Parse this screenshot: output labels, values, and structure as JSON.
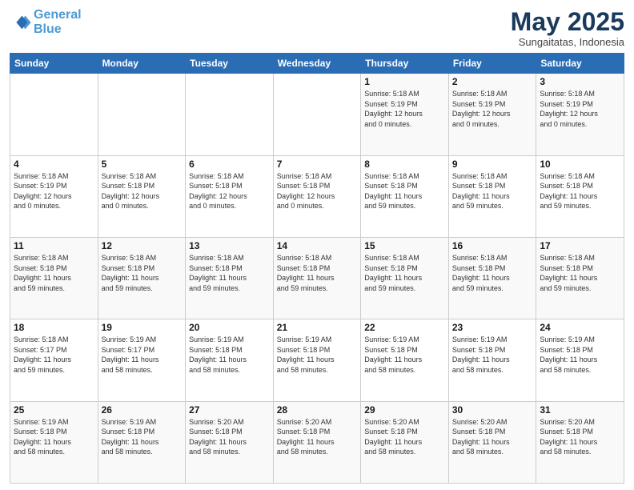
{
  "header": {
    "logo_line1": "General",
    "logo_line2": "Blue",
    "month": "May 2025",
    "location": "Sungaitatas, Indonesia"
  },
  "weekdays": [
    "Sunday",
    "Monday",
    "Tuesday",
    "Wednesday",
    "Thursday",
    "Friday",
    "Saturday"
  ],
  "weeks": [
    [
      {
        "day": "",
        "text": ""
      },
      {
        "day": "",
        "text": ""
      },
      {
        "day": "",
        "text": ""
      },
      {
        "day": "",
        "text": ""
      },
      {
        "day": "1",
        "text": "Sunrise: 5:18 AM\nSunset: 5:19 PM\nDaylight: 12 hours\nand 0 minutes."
      },
      {
        "day": "2",
        "text": "Sunrise: 5:18 AM\nSunset: 5:19 PM\nDaylight: 12 hours\nand 0 minutes."
      },
      {
        "day": "3",
        "text": "Sunrise: 5:18 AM\nSunset: 5:19 PM\nDaylight: 12 hours\nand 0 minutes."
      }
    ],
    [
      {
        "day": "4",
        "text": "Sunrise: 5:18 AM\nSunset: 5:19 PM\nDaylight: 12 hours\nand 0 minutes."
      },
      {
        "day": "5",
        "text": "Sunrise: 5:18 AM\nSunset: 5:18 PM\nDaylight: 12 hours\nand 0 minutes."
      },
      {
        "day": "6",
        "text": "Sunrise: 5:18 AM\nSunset: 5:18 PM\nDaylight: 12 hours\nand 0 minutes."
      },
      {
        "day": "7",
        "text": "Sunrise: 5:18 AM\nSunset: 5:18 PM\nDaylight: 12 hours\nand 0 minutes."
      },
      {
        "day": "8",
        "text": "Sunrise: 5:18 AM\nSunset: 5:18 PM\nDaylight: 11 hours\nand 59 minutes."
      },
      {
        "day": "9",
        "text": "Sunrise: 5:18 AM\nSunset: 5:18 PM\nDaylight: 11 hours\nand 59 minutes."
      },
      {
        "day": "10",
        "text": "Sunrise: 5:18 AM\nSunset: 5:18 PM\nDaylight: 11 hours\nand 59 minutes."
      }
    ],
    [
      {
        "day": "11",
        "text": "Sunrise: 5:18 AM\nSunset: 5:18 PM\nDaylight: 11 hours\nand 59 minutes."
      },
      {
        "day": "12",
        "text": "Sunrise: 5:18 AM\nSunset: 5:18 PM\nDaylight: 11 hours\nand 59 minutes."
      },
      {
        "day": "13",
        "text": "Sunrise: 5:18 AM\nSunset: 5:18 PM\nDaylight: 11 hours\nand 59 minutes."
      },
      {
        "day": "14",
        "text": "Sunrise: 5:18 AM\nSunset: 5:18 PM\nDaylight: 11 hours\nand 59 minutes."
      },
      {
        "day": "15",
        "text": "Sunrise: 5:18 AM\nSunset: 5:18 PM\nDaylight: 11 hours\nand 59 minutes."
      },
      {
        "day": "16",
        "text": "Sunrise: 5:18 AM\nSunset: 5:18 PM\nDaylight: 11 hours\nand 59 minutes."
      },
      {
        "day": "17",
        "text": "Sunrise: 5:18 AM\nSunset: 5:18 PM\nDaylight: 11 hours\nand 59 minutes."
      }
    ],
    [
      {
        "day": "18",
        "text": "Sunrise: 5:18 AM\nSunset: 5:17 PM\nDaylight: 11 hours\nand 59 minutes."
      },
      {
        "day": "19",
        "text": "Sunrise: 5:19 AM\nSunset: 5:17 PM\nDaylight: 11 hours\nand 58 minutes."
      },
      {
        "day": "20",
        "text": "Sunrise: 5:19 AM\nSunset: 5:18 PM\nDaylight: 11 hours\nand 58 minutes."
      },
      {
        "day": "21",
        "text": "Sunrise: 5:19 AM\nSunset: 5:18 PM\nDaylight: 11 hours\nand 58 minutes."
      },
      {
        "day": "22",
        "text": "Sunrise: 5:19 AM\nSunset: 5:18 PM\nDaylight: 11 hours\nand 58 minutes."
      },
      {
        "day": "23",
        "text": "Sunrise: 5:19 AM\nSunset: 5:18 PM\nDaylight: 11 hours\nand 58 minutes."
      },
      {
        "day": "24",
        "text": "Sunrise: 5:19 AM\nSunset: 5:18 PM\nDaylight: 11 hours\nand 58 minutes."
      }
    ],
    [
      {
        "day": "25",
        "text": "Sunrise: 5:19 AM\nSunset: 5:18 PM\nDaylight: 11 hours\nand 58 minutes."
      },
      {
        "day": "26",
        "text": "Sunrise: 5:19 AM\nSunset: 5:18 PM\nDaylight: 11 hours\nand 58 minutes."
      },
      {
        "day": "27",
        "text": "Sunrise: 5:20 AM\nSunset: 5:18 PM\nDaylight: 11 hours\nand 58 minutes."
      },
      {
        "day": "28",
        "text": "Sunrise: 5:20 AM\nSunset: 5:18 PM\nDaylight: 11 hours\nand 58 minutes."
      },
      {
        "day": "29",
        "text": "Sunrise: 5:20 AM\nSunset: 5:18 PM\nDaylight: 11 hours\nand 58 minutes."
      },
      {
        "day": "30",
        "text": "Sunrise: 5:20 AM\nSunset: 5:18 PM\nDaylight: 11 hours\nand 58 minutes."
      },
      {
        "day": "31",
        "text": "Sunrise: 5:20 AM\nSunset: 5:18 PM\nDaylight: 11 hours\nand 58 minutes."
      }
    ]
  ]
}
